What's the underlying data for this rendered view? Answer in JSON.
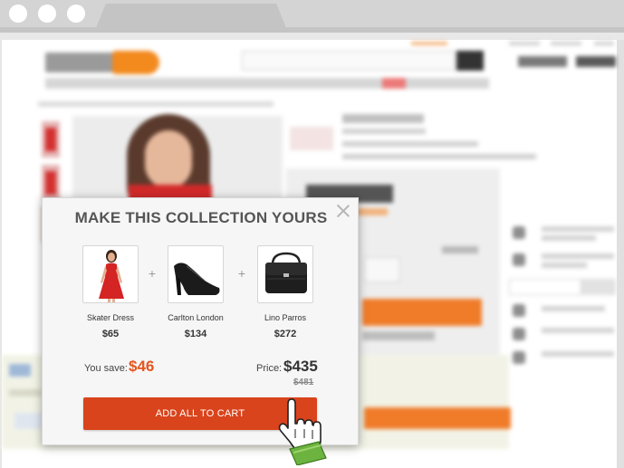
{
  "modal": {
    "title": "MAKE THIS COLLECTION YOURS",
    "close_icon": "close-icon",
    "products": [
      {
        "name": "Skater Dress",
        "price": "$65",
        "icon": "red-dress-image"
      },
      {
        "name": "Carlton London",
        "price": "$134",
        "icon": "black-shoe-image"
      },
      {
        "name": "Lino Parros",
        "price": "$272",
        "icon": "black-handbag-image"
      }
    ],
    "plus_sign": "+",
    "save_label": "You save:",
    "save_value": "$46",
    "price_label": "Price:",
    "price_value": "$435",
    "original_price": "$481",
    "cta_label": "ADD ALL TO CART"
  },
  "colors": {
    "accent": "#d9441c",
    "save": "#e4551f",
    "cursor_cuff": "#6db33f"
  }
}
